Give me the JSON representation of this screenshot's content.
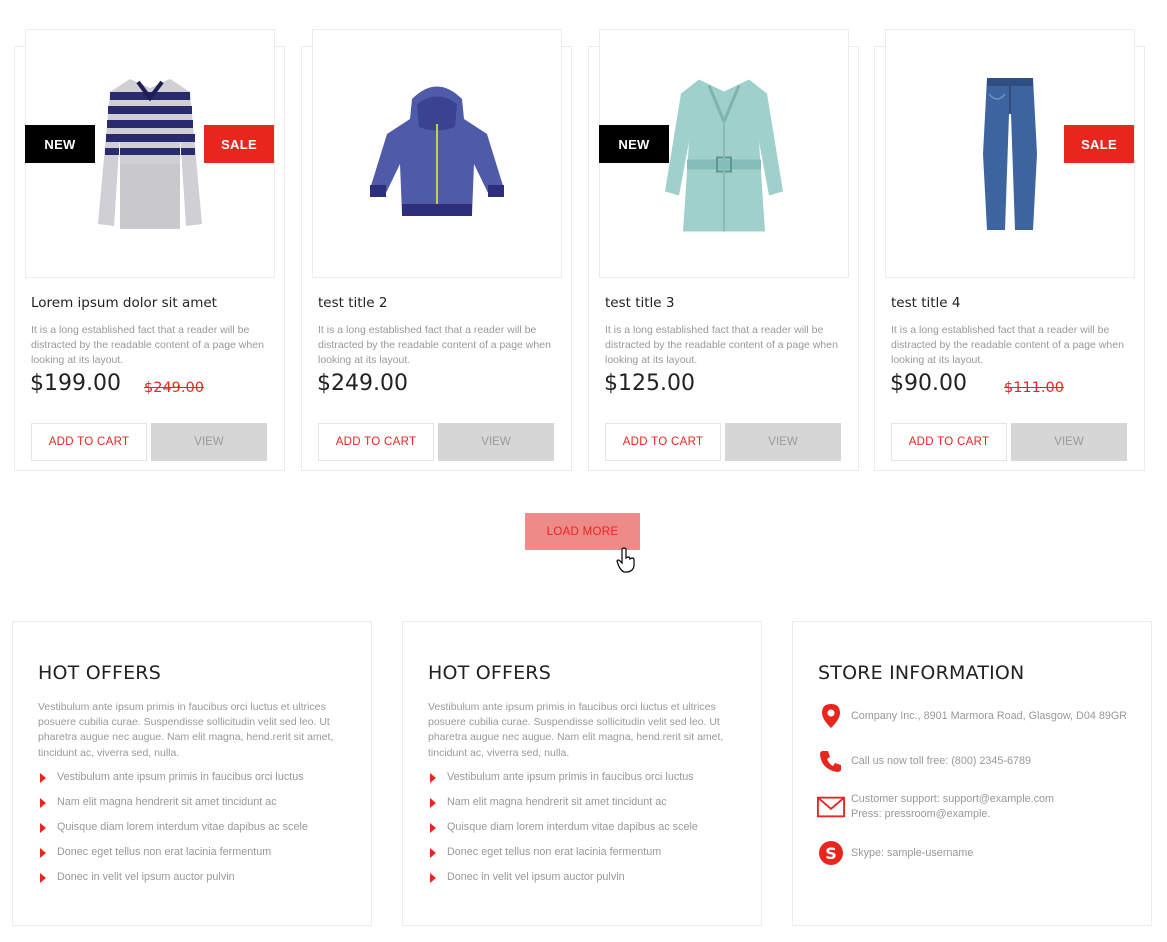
{
  "products": [
    {
      "title": "Lorem ipsum dolor sit amet",
      "desc": "It is a long established fact that a reader will be distracted by the readable content of a page when looking at its layout.",
      "price": "$199.00",
      "old_price": "$249.00",
      "badge_left": "NEW",
      "badge_right": "SALE",
      "image": "striped-sweater",
      "cart_label": "ADD TO CART",
      "view_label": "VIEW"
    },
    {
      "title": "test title 2",
      "desc": "It is a long established fact that a reader will be distracted by the readable content of a page when looking at its layout.",
      "price": "$249.00",
      "old_price": "",
      "badge_left": "",
      "badge_right": "",
      "image": "blue-hoodie",
      "cart_label": "ADD TO CART",
      "view_label": "VIEW"
    },
    {
      "title": "test title 3",
      "desc": "It is a long established fact that a reader will be distracted by the readable content of a page when looking at its layout.",
      "price": "$125.00",
      "old_price": "",
      "badge_left": "NEW",
      "badge_right": "",
      "image": "mint-trench-coat",
      "cart_label": "ADD TO CART",
      "view_label": "VIEW"
    },
    {
      "title": "test title 4",
      "desc": "It is a long established fact that a reader will be distracted by the readable content of a page when looking at its layout.",
      "price": "$90.00",
      "old_price": "$111.00",
      "badge_left": "",
      "badge_right": "SALE",
      "image": "blue-jeans",
      "cart_label": "ADD TO CART",
      "view_label": "VIEW"
    }
  ],
  "load_more": "LOAD MORE",
  "footer": {
    "offers": [
      {
        "title": "HOT OFFERS",
        "text": "Vestibulum ante ipsum primis in faucibus orci luctus et ultrices posuere cubilia curae. Suspendisse sollicitudin velit sed leo. Ut pharetra augue nec augue. Nam elit magna, hend.rerit sit amet, tincidunt ac, viverra sed, nulla.",
        "items": [
          "Vestibulum ante ipsum primis in faucibus orci luctus",
          "Nam elit magna hendrerit sit amet tincidunt ac",
          "Quisque diam lorem interdum vitae dapibus ac scele",
          "Donec eget tellus non erat lacinia fermentum",
          "Donec in velit vel ipsum auctor pulvin"
        ]
      },
      {
        "title": "HOT OFFERS",
        "text": "Vestibulum ante ipsum primis in faucibus orci luctus et ultrices posuere cubilia curae. Suspendisse sollicitudin velit sed leo. Ut pharetra augue nec augue. Nam elit magna, hend.rerit sit amet, tincidunt ac, viverra sed, nulla.",
        "items": [
          "Vestibulum ante ipsum primis in faucibus orci luctus",
          "Nam elit magna hendrerit sit amet tincidunt ac",
          "Quisque diam lorem interdum vitae dapibus ac scele",
          "Donec eget tellus non erat lacinia fermentum",
          "Donec in velit vel ipsum auctor pulvin"
        ]
      }
    ],
    "store": {
      "title": "STORE INFORMATION",
      "address": "Company Inc., 8901 Marmora Road, Glasgow, D04 89GR",
      "phone": "Call us now toll free: (800) 2345-6789",
      "email_line1": "Customer support: support@example.com",
      "email_line2": "Press: pressroom@example.",
      "skype": "Skype: sample-username",
      "icons": [
        "location-pin-icon",
        "phone-icon",
        "envelope-icon",
        "skype-icon"
      ]
    }
  },
  "colors": {
    "accent": "#e8261e",
    "badge_new": "#000000",
    "view_bg": "#d6d6d6",
    "load_more_bg": "#ee8a87"
  }
}
